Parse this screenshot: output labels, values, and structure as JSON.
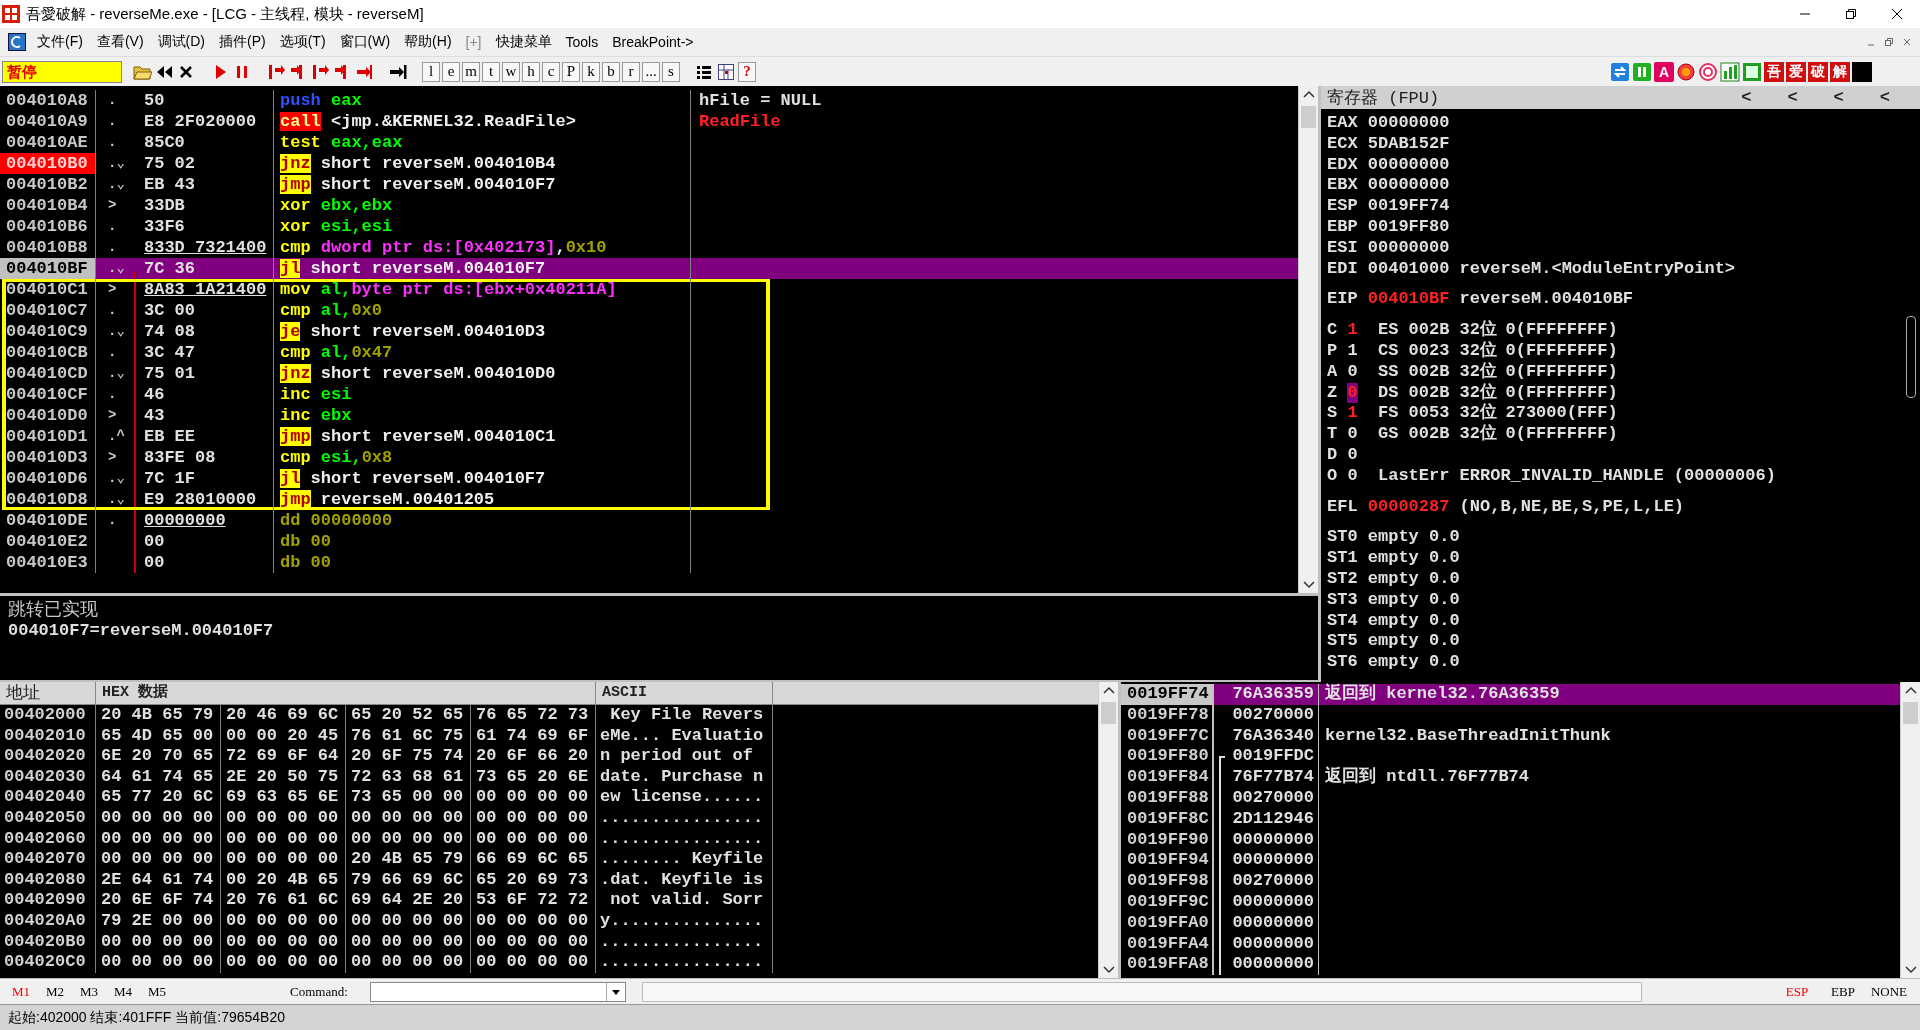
{
  "window": {
    "title": "吾愛破解 - reverseMe.exe - [LCG - 主线程, 模块 - reverseM]"
  },
  "menu": {
    "items": [
      {
        "label": "文件(F)",
        "disabled": false
      },
      {
        "label": "查看(V)",
        "disabled": false
      },
      {
        "label": "调试(D)",
        "disabled": false
      },
      {
        "label": "插件(P)",
        "disabled": false
      },
      {
        "label": "选项(T)",
        "disabled": false
      },
      {
        "label": "窗口(W)",
        "disabled": false
      },
      {
        "label": "帮助(H)",
        "disabled": false
      },
      {
        "label": "[+]",
        "disabled": true
      },
      {
        "label": "快捷菜单",
        "disabled": false
      },
      {
        "label": "Tools",
        "disabled": false
      },
      {
        "label": "BreakPoint->",
        "disabled": false
      }
    ]
  },
  "toolbar": {
    "status": "暂停",
    "letter_buttons": [
      "l",
      "e",
      "m",
      "t",
      "w",
      "h",
      "c",
      "P",
      "k",
      "b",
      "r",
      "...",
      "s"
    ],
    "help_button": "?",
    "a_button": "A",
    "tag_buttons": [
      "吾",
      "爱",
      "破",
      "解"
    ]
  },
  "disassembly": {
    "rows": [
      {
        "address": "004010A8",
        "marker": ".",
        "hex": "50",
        "mnemonic": "push",
        "kind": "push",
        "operands": [
          {
            "text": "eax",
            "kind": "reg"
          }
        ],
        "comment": "hFile = NULL",
        "api": false,
        "selected": false,
        "breakpoint": false,
        "framed": false,
        "underlined": false
      },
      {
        "address": "004010A9",
        "marker": ".",
        "hex": "E8 2F020000",
        "mnemonic": "call",
        "kind": "call",
        "operands": [
          {
            "text": "<jmp.&KERNEL32.ReadFile>",
            "kind": "label"
          }
        ],
        "comment": "ReadFile",
        "api": true,
        "selected": false,
        "breakpoint": false,
        "framed": false,
        "underlined": false
      },
      {
        "address": "004010AE",
        "marker": ".",
        "hex": "85C0",
        "mnemonic": "test",
        "kind": "plain",
        "operands": [
          {
            "text": "eax,eax",
            "kind": "reg"
          }
        ],
        "selected": false,
        "breakpoint": false,
        "framed": false,
        "underlined": false
      },
      {
        "address": "004010B0",
        "marker": ".⌄",
        "hex": "75 02",
        "mnemonic": "jnz",
        "kind": "jump",
        "operands": [
          {
            "text": "short reverseM.004010B4",
            "kind": "label"
          }
        ],
        "selected": false,
        "breakpoint": true,
        "framed": false,
        "underlined": false
      },
      {
        "address": "004010B2",
        "marker": ".⌄",
        "hex": "EB 43",
        "mnemonic": "jmp",
        "kind": "jump",
        "operands": [
          {
            "text": "short reverseM.004010F7",
            "kind": "label"
          }
        ],
        "selected": false,
        "breakpoint": false,
        "framed": false,
        "underlined": false
      },
      {
        "address": "004010B4",
        "marker": ">",
        "hex": "33DB",
        "mnemonic": "xor",
        "kind": "plain",
        "operands": [
          {
            "text": "ebx,ebx",
            "kind": "reg"
          }
        ],
        "selected": false,
        "breakpoint": false,
        "framed": false,
        "underlined": false
      },
      {
        "address": "004010B6",
        "marker": ".",
        "hex": "33F6",
        "mnemonic": "xor",
        "kind": "plain",
        "operands": [
          {
            "text": "esi,esi",
            "kind": "reg"
          }
        ],
        "selected": false,
        "breakpoint": false,
        "framed": false,
        "underlined": false
      },
      {
        "address": "004010B8",
        "marker": ".",
        "hex": "833D 7321400",
        "mnemonic": "cmp",
        "kind": "plain",
        "operands": [
          {
            "text": "dword ptr ds:[0x402173]",
            "kind": "mem"
          },
          {
            "text": ",",
            "kind": "sep"
          },
          {
            "text": "0x10",
            "kind": "num"
          }
        ],
        "selected": false,
        "breakpoint": false,
        "framed": false,
        "underlined": true
      },
      {
        "address": "004010BF",
        "marker": ".⌄",
        "hex": "7C 36",
        "mnemonic": "jl",
        "kind": "jump",
        "operands": [
          {
            "text": "short reverseM.004010F7",
            "kind": "label"
          }
        ],
        "selected": true,
        "breakpoint": false,
        "framed": false,
        "underlined": false
      },
      {
        "address": "004010C1",
        "marker": ">",
        "hex": "8A83 1A21400",
        "mnemonic": "mov",
        "kind": "plain",
        "operands": [
          {
            "text": "al,",
            "kind": "reg"
          },
          {
            "text": "byte ptr ds:[ebx+0x40211A]",
            "kind": "mem"
          }
        ],
        "selected": false,
        "breakpoint": false,
        "framed": true,
        "underlined": true
      },
      {
        "address": "004010C7",
        "marker": ".",
        "hex": "3C 00",
        "mnemonic": "cmp",
        "kind": "plain",
        "operands": [
          {
            "text": "al,",
            "kind": "reg"
          },
          {
            "text": "0x0",
            "kind": "num"
          }
        ],
        "selected": false,
        "breakpoint": false,
        "framed": true,
        "underlined": false
      },
      {
        "address": "004010C9",
        "marker": ".⌄",
        "hex": "74 08",
        "mnemonic": "je",
        "kind": "jump",
        "operands": [
          {
            "text": "short reverseM.004010D3",
            "kind": "label"
          }
        ],
        "selected": false,
        "breakpoint": false,
        "framed": true,
        "underlined": false
      },
      {
        "address": "004010CB",
        "marker": ".",
        "hex": "3C 47",
        "mnemonic": "cmp",
        "kind": "plain",
        "operands": [
          {
            "text": "al,",
            "kind": "reg"
          },
          {
            "text": "0x47",
            "kind": "num"
          }
        ],
        "selected": false,
        "breakpoint": false,
        "framed": true,
        "underlined": false
      },
      {
        "address": "004010CD",
        "marker": ".⌄",
        "hex": "75 01",
        "mnemonic": "jnz",
        "kind": "jump",
        "operands": [
          {
            "text": "short reverseM.004010D0",
            "kind": "label"
          }
        ],
        "selected": false,
        "breakpoint": false,
        "framed": true,
        "underlined": false
      },
      {
        "address": "004010CF",
        "marker": ".",
        "hex": "46",
        "mnemonic": "inc",
        "kind": "plain",
        "operands": [
          {
            "text": "esi",
            "kind": "reg"
          }
        ],
        "selected": false,
        "breakpoint": false,
        "framed": true,
        "underlined": false
      },
      {
        "address": "004010D0",
        "marker": ">",
        "hex": "43",
        "mnemonic": "inc",
        "kind": "plain",
        "operands": [
          {
            "text": "ebx",
            "kind": "reg"
          }
        ],
        "selected": false,
        "breakpoint": false,
        "framed": true,
        "underlined": false
      },
      {
        "address": "004010D1",
        "marker": ".^",
        "hex": "EB EE",
        "mnemonic": "jmp",
        "kind": "jump",
        "operands": [
          {
            "text": "short reverseM.004010C1",
            "kind": "label"
          }
        ],
        "selected": false,
        "breakpoint": false,
        "framed": true,
        "underlined": false
      },
      {
        "address": "004010D3",
        "marker": ">",
        "hex": "83FE 08",
        "mnemonic": "cmp",
        "kind": "plain",
        "operands": [
          {
            "text": "esi,",
            "kind": "reg"
          },
          {
            "text": "0x8",
            "kind": "num"
          }
        ],
        "selected": false,
        "breakpoint": false,
        "framed": true,
        "underlined": false
      },
      {
        "address": "004010D6",
        "marker": ".⌄",
        "hex": "7C 1F",
        "mnemonic": "jl",
        "kind": "jump",
        "operands": [
          {
            "text": "short reverseM.004010F7",
            "kind": "label"
          }
        ],
        "selected": false,
        "breakpoint": false,
        "framed": true,
        "underlined": false
      },
      {
        "address": "004010D8",
        "marker": ".⌄",
        "hex": "E9 28010000",
        "mnemonic": "jmp",
        "kind": "jump",
        "operands": [
          {
            "text": "reverseM.00401205",
            "kind": "label"
          }
        ],
        "selected": false,
        "breakpoint": false,
        "framed": true,
        "underlined": false
      },
      {
        "address": "004010DE",
        "marker": ".",
        "hex": "00000000",
        "mnemonic": "dd",
        "kind": "data",
        "operands": [
          {
            "text": "00000000",
            "kind": "num"
          }
        ],
        "selected": false,
        "breakpoint": false,
        "framed": false,
        "underlined": true
      },
      {
        "address": "004010E2",
        "hex": "00",
        "mnemonic": "db",
        "kind": "data",
        "operands": [
          {
            "text": "00",
            "kind": "num"
          }
        ],
        "selected": false,
        "breakpoint": false,
        "framed": false,
        "underlined": false
      },
      {
        "address": "004010E3",
        "hex": "00",
        "mnemonic": "db",
        "kind": "data",
        "operands": [
          {
            "text": "00",
            "kind": "num"
          }
        ],
        "selected": false,
        "breakpoint": false,
        "framed": false,
        "underlined": false
      }
    ]
  },
  "info": {
    "title": "跳转已实现",
    "line": "004010F7=reverseM.004010F7"
  },
  "registers": {
    "title": "寄存器 (FPU)",
    "nav": [
      "<",
      "<",
      "<",
      "<"
    ],
    "general": [
      {
        "name": "EAX",
        "value": "00000000",
        "changed": false
      },
      {
        "name": "ECX",
        "value": "5DAB152F",
        "changed": false
      },
      {
        "name": "EDX",
        "value": "00000000",
        "changed": false
      },
      {
        "name": "EBX",
        "value": "00000000",
        "changed": false
      },
      {
        "name": "ESP",
        "value": "0019FF74",
        "changed": false
      },
      {
        "name": "EBP",
        "value": "0019FF80",
        "changed": false
      },
      {
        "name": "ESI",
        "value": "00000000",
        "changed": false
      },
      {
        "name": "EDI",
        "value": "00401000",
        "note": "reverseM.<ModuleEntryPoint>",
        "changed": false
      }
    ],
    "eip": {
      "name": "EIP",
      "value": "004010BF",
      "note": "reverseM.004010BF",
      "changed": true
    },
    "flags": [
      {
        "name": "C",
        "value": "1",
        "changed": true,
        "selected": false,
        "segment": {
          "name": "ES",
          "selector": "002B",
          "bits": "32位",
          "limit": "0(FFFFFFFF)"
        }
      },
      {
        "name": "P",
        "value": "1",
        "changed": false,
        "selected": false,
        "segment": {
          "name": "CS",
          "selector": "0023",
          "bits": "32位",
          "limit": "0(FFFFFFFF)"
        }
      },
      {
        "name": "A",
        "value": "0",
        "changed": false,
        "selected": false,
        "segment": {
          "name": "SS",
          "selector": "002B",
          "bits": "32位",
          "limit": "0(FFFFFFFF)"
        }
      },
      {
        "name": "Z",
        "value": "0",
        "changed": true,
        "selected": true,
        "segment": {
          "name": "DS",
          "selector": "002B",
          "bits": "32位",
          "limit": "0(FFFFFFFF)"
        }
      },
      {
        "name": "S",
        "value": "1",
        "changed": true,
        "selected": false,
        "segment": {
          "name": "FS",
          "selector": "0053",
          "bits": "32位",
          "limit": "273000(FFF)"
        }
      },
      {
        "name": "T",
        "value": "0",
        "changed": false,
        "selected": false,
        "segment": {
          "name": "GS",
          "selector": "002B",
          "bits": "32位",
          "limit": "0(FFFFFFFF)"
        }
      },
      {
        "name": "D",
        "value": "0",
        "changed": false,
        "selected": false
      },
      {
        "name": "O",
        "value": "0",
        "changed": false,
        "selected": false,
        "last_error": {
          "label": "LastErr",
          "value": "ERROR_INVALID_HANDLE (00000006)"
        }
      }
    ],
    "efl": {
      "name": "EFL",
      "value": "00000287",
      "note": "(NO,B,NE,BE,S,PE,L,LE)",
      "changed": true
    },
    "fpu": [
      {
        "name": "ST0",
        "tag": "empty",
        "value": "0.0"
      },
      {
        "name": "ST1",
        "tag": "empty",
        "value": "0.0"
      },
      {
        "name": "ST2",
        "tag": "empty",
        "value": "0.0"
      },
      {
        "name": "ST3",
        "tag": "empty",
        "value": "0.0"
      },
      {
        "name": "ST4",
        "tag": "empty",
        "value": "0.0"
      },
      {
        "name": "ST5",
        "tag": "empty",
        "value": "0.0"
      },
      {
        "name": "ST6",
        "tag": "empty",
        "value": "0.0"
      }
    ]
  },
  "dump": {
    "columns": [
      "地址",
      "HEX 数据",
      "ASCII"
    ],
    "rows": [
      {
        "address": "00402000",
        "hex": [
          "20 4B 65 79",
          "20 46 69 6C",
          "65 20 52 65",
          "76 65 72 73"
        ],
        "ascii": " Key File Revers"
      },
      {
        "address": "00402010",
        "hex": [
          "65 4D 65 00",
          "00 00 20 45",
          "76 61 6C 75",
          "61 74 69 6F"
        ],
        "ascii": "eMe... Evaluatio"
      },
      {
        "address": "00402020",
        "hex": [
          "6E 20 70 65",
          "72 69 6F 64",
          "20 6F 75 74",
          "20 6F 66 20"
        ],
        "ascii": "n period out of "
      },
      {
        "address": "00402030",
        "hex": [
          "64 61 74 65",
          "2E 20 50 75",
          "72 63 68 61",
          "73 65 20 6E"
        ],
        "ascii": "date. Purchase n"
      },
      {
        "address": "00402040",
        "hex": [
          "65 77 20 6C",
          "69 63 65 6E",
          "73 65 00 00",
          "00 00 00 00"
        ],
        "ascii": "ew license......"
      },
      {
        "address": "00402050",
        "hex": [
          "00 00 00 00",
          "00 00 00 00",
          "00 00 00 00",
          "00 00 00 00"
        ],
        "ascii": "................"
      },
      {
        "address": "00402060",
        "hex": [
          "00 00 00 00",
          "00 00 00 00",
          "00 00 00 00",
          "00 00 00 00"
        ],
        "ascii": "................"
      },
      {
        "address": "00402070",
        "hex": [
          "00 00 00 00",
          "00 00 00 00",
          "20 4B 65 79",
          "66 69 6C 65"
        ],
        "ascii": "........ Keyfile"
      },
      {
        "address": "00402080",
        "hex": [
          "2E 64 61 74",
          "00 20 4B 65",
          "79 66 69 6C",
          "65 20 69 73"
        ],
        "ascii": ".dat. Keyfile is"
      },
      {
        "address": "00402090",
        "hex": [
          "20 6E 6F 74",
          "20 76 61 6C",
          "69 64 2E 20",
          "53 6F 72 72"
        ],
        "ascii": " not valid. Sorr"
      },
      {
        "address": "004020A0",
        "hex": [
          "79 2E 00 00",
          "00 00 00 00",
          "00 00 00 00",
          "00 00 00 00"
        ],
        "ascii": "y..............."
      },
      {
        "address": "004020B0",
        "hex": [
          "00 00 00 00",
          "00 00 00 00",
          "00 00 00 00",
          "00 00 00 00"
        ],
        "ascii": "................"
      },
      {
        "address": "004020C0",
        "hex": [
          "00 00 00 00",
          "00 00 00 00",
          "00 00 00 00",
          "00 00 00 00"
        ],
        "ascii": "................"
      }
    ]
  },
  "stack": {
    "rows": [
      {
        "address": "0019FF74",
        "value": "76A36359",
        "comment": "返回到 kernel32.76A36359",
        "selected": true,
        "frame_start": false
      },
      {
        "address": "0019FF78",
        "value": "00270000",
        "selected": false,
        "frame_start": false
      },
      {
        "address": "0019FF7C",
        "value": "76A36340",
        "comment": "kernel32.BaseThreadInitThunk",
        "selected": false,
        "frame_start": false
      },
      {
        "address": "0019FF80",
        "value": "0019FFDC",
        "selected": false,
        "frame_start": true
      },
      {
        "address": "0019FF84",
        "value": "76F77B74",
        "comment": "返回到 ntdll.76F77B74",
        "selected": false,
        "frame_start": false
      },
      {
        "address": "0019FF88",
        "value": "00270000",
        "selected": false,
        "frame_start": false
      },
      {
        "address": "0019FF8C",
        "value": "2D112946",
        "selected": false,
        "frame_start": false
      },
      {
        "address": "0019FF90",
        "value": "00000000",
        "selected": false,
        "frame_start": false
      },
      {
        "address": "0019FF94",
        "value": "00000000",
        "selected": false,
        "frame_start": false
      },
      {
        "address": "0019FF98",
        "value": "00270000",
        "selected": false,
        "frame_start": false
      },
      {
        "address": "0019FF9C",
        "value": "00000000",
        "selected": false,
        "frame_start": false
      },
      {
        "address": "0019FFA0",
        "value": "00000000",
        "selected": false,
        "frame_start": false
      },
      {
        "address": "0019FFA4",
        "value": "00000000",
        "selected": false,
        "frame_start": false
      },
      {
        "address": "0019FFA8",
        "value": "00000000",
        "selected": false,
        "frame_start": false
      }
    ]
  },
  "bottom_bar": {
    "memory_tabs": [
      {
        "label": "M1",
        "selected": true
      },
      {
        "label": "M2",
        "selected": false
      },
      {
        "label": "M3",
        "selected": false
      },
      {
        "label": "M4",
        "selected": false
      },
      {
        "label": "M5",
        "selected": false
      }
    ],
    "command_label": "Command:",
    "stack_modes": [
      {
        "label": "ESP",
        "selected": true
      },
      {
        "label": "EBP",
        "selected": false
      },
      {
        "label": "NONE",
        "selected": false
      }
    ]
  },
  "status_bar": {
    "text": "起始:402000 结束:401FFF 当前值:79654B20"
  }
}
